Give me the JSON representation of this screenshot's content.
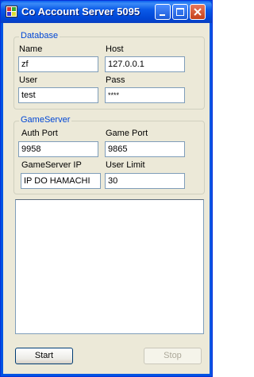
{
  "window": {
    "title": "Co Account Server 5095"
  },
  "database": {
    "legend": "Database",
    "name_label": "Name",
    "name_value": "zf",
    "host_label": "Host",
    "host_value": "127.0.0.1",
    "user_label": "User",
    "user_value": "test",
    "pass_label": "Pass",
    "pass_value": "****"
  },
  "gameserver": {
    "legend": "GameServer",
    "auth_port_label": "Auth Port",
    "auth_port_value": "9958",
    "game_port_label": "Game Port",
    "game_port_value": "9865",
    "ip_label": "GameServer IP",
    "ip_value": "IP DO HAMACHI",
    "user_limit_label": "User Limit",
    "user_limit_value": "30"
  },
  "buttons": {
    "start": "Start",
    "stop": "Stop"
  },
  "colors": {
    "accent": "#0046d5",
    "face": "#ece9d8"
  }
}
